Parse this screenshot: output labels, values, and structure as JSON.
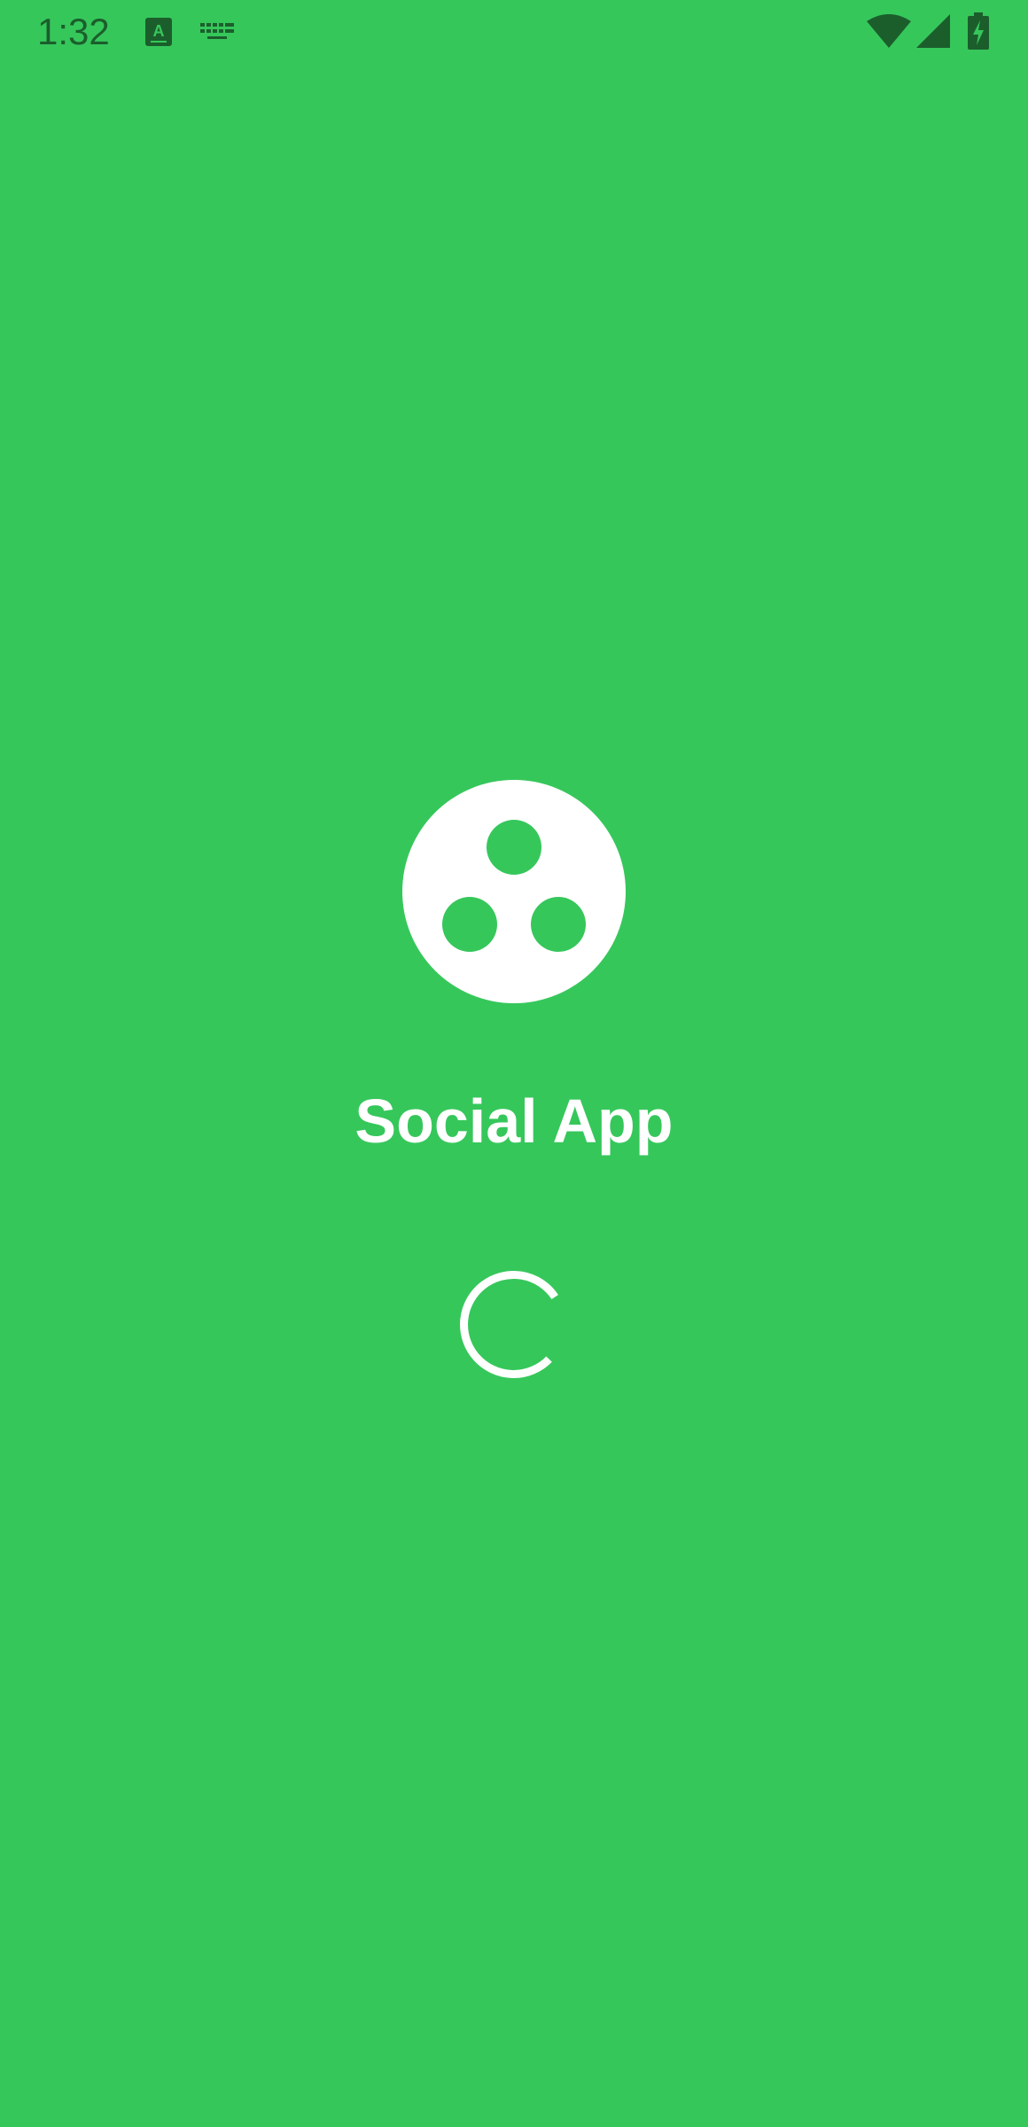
{
  "status_bar": {
    "time": "1:32",
    "icons": [
      "text-a-icon",
      "keyboard-icon",
      "wifi-icon",
      "cell-signal-icon",
      "battery-charging-icon"
    ],
    "icon_color": "#1b5e2c"
  },
  "splash": {
    "background_color": "#36c75b",
    "logo_icon": "social-app-logo-icon",
    "app_name": "Social App",
    "loading_indicator": "loading-spinner"
  }
}
